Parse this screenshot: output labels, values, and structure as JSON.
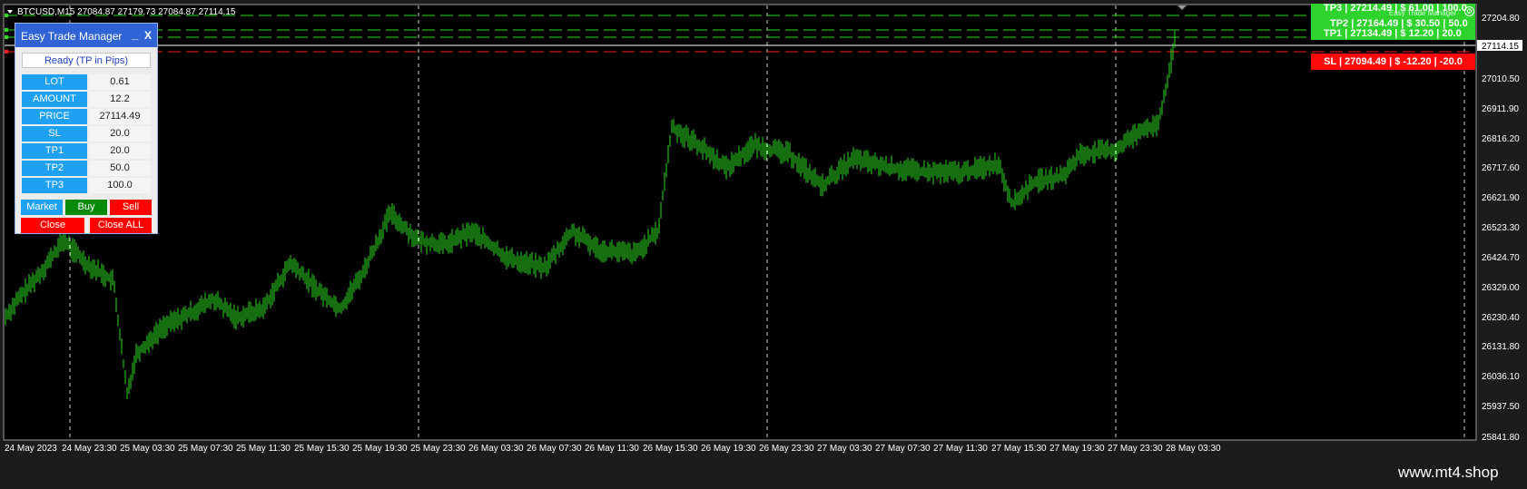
{
  "chart": {
    "symbol_line": "BTCUSD,M15  27084.87 27179.73 27084.87 27114.15",
    "price_ticks": [
      "27204.80",
      "27010.50",
      "26911.90",
      "26816.20",
      "26717.60",
      "26621.90",
      "26523.30",
      "26424.70",
      "26329.00",
      "26230.40",
      "26131.80",
      "26036.10",
      "25937.50",
      "25841.80"
    ],
    "current_price": "27114.15",
    "time_labels": [
      "24 May 2023",
      "24 May 23:30",
      "25 May 03:30",
      "25 May 07:30",
      "25 May 11:30",
      "25 May 15:30",
      "25 May 19:30",
      "25 May 23:30",
      "26 May 03:30",
      "26 May 07:30",
      "26 May 11:30",
      "26 May 15:30",
      "26 May 19:30",
      "26 May 23:30",
      "27 May 03:30",
      "27 May 07:30",
      "27 May 11:30",
      "27 May 15:30",
      "27 May 19:30",
      "27 May 23:30",
      "28 May 03:30"
    ],
    "candle_color": "#2bdc1f",
    "ask_line_color": "#ffffff",
    "tp_line_color": "#2bdc1f",
    "sl_line_color": "#ff2020"
  },
  "panel": {
    "title": "Easy Trade Manager",
    "minimize": "_",
    "close": "X",
    "status": "Ready (TP in Pips)",
    "rows": [
      {
        "label": "LOT",
        "value": "0.61"
      },
      {
        "label": "AMOUNT",
        "value": "12.2"
      },
      {
        "label": "PRICE",
        "value": "27114.49"
      },
      {
        "label": "SL",
        "value": "20.0"
      },
      {
        "label": "TP1",
        "value": "20.0"
      },
      {
        "label": "TP2",
        "value": "50.0"
      },
      {
        "label": "TP3",
        "value": "100.0"
      }
    ],
    "market_label": "Market",
    "buy_label": "Buy",
    "sell_label": "Sell",
    "close_label": "Close",
    "close_all_label": "Close ALL",
    "accent_color": "#1ea1f2",
    "buy_color": "#0a8a0a",
    "sell_color": "#ff0000"
  },
  "tags": {
    "tp3": "TP3 | 27214.49 | $ 61.00 | 100.0",
    "tp2": "TP2 | 27164.49 | $ 30.50 | 50.0",
    "tp1": "TP1 | 27134.49 | $ 12.20 | 20.0",
    "sl": "SL | 27094.49 | $ -12.20 | -20.0",
    "overlay": "Easy Trade Manager"
  },
  "watermark": "www.mt4.shop"
}
